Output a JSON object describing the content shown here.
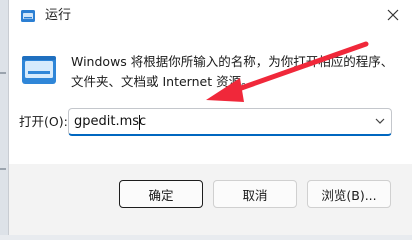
{
  "window": {
    "title": "运行"
  },
  "icons": {
    "app": "run-icon",
    "close": "close-icon",
    "dropdown": "chevron-down-icon"
  },
  "description": {
    "line1": "Windows 将根据你所输入的名称，为你打开相应的程序、",
    "line2": "文件夹、文档或 Internet 资源。"
  },
  "open": {
    "label": "打开(O):",
    "value": "gpedit.msc"
  },
  "buttons": {
    "ok": "确定",
    "cancel": "取消",
    "browse": "浏览(B)..."
  },
  "colors": {
    "accent": "#0067c0",
    "annotation_arrow": "#f0283a"
  }
}
